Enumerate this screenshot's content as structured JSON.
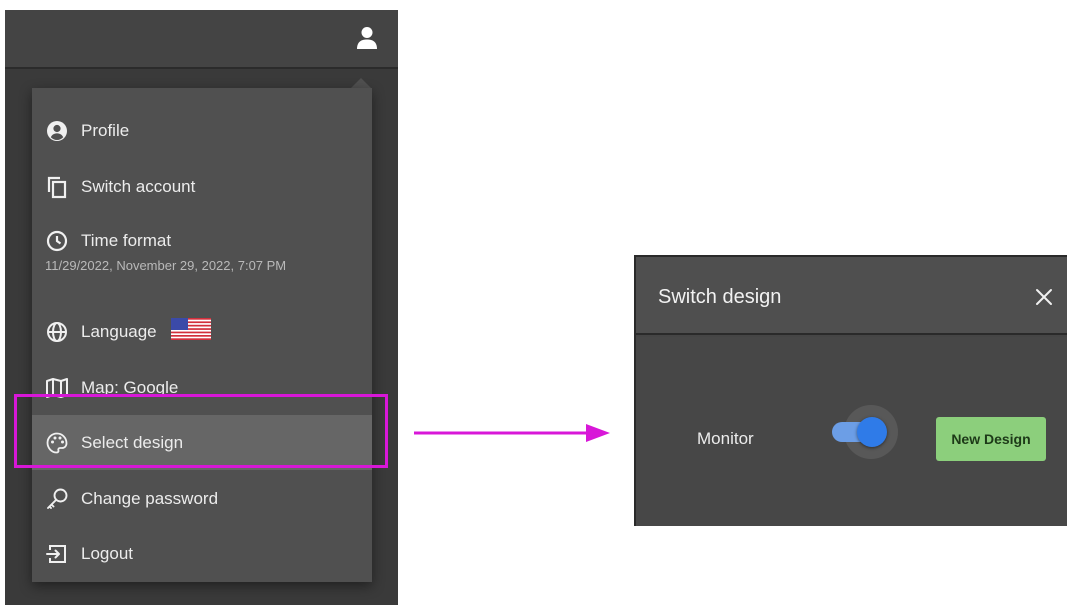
{
  "menu": {
    "items": [
      {
        "label": "Profile",
        "icon": "account-circle-icon"
      },
      {
        "label": "Switch account",
        "icon": "copy-icon"
      },
      {
        "label": "Time format",
        "sub": "11/29/2022, November 29, 2022, 7:07 PM",
        "icon": "clock-icon"
      },
      {
        "label": "Language",
        "icon": "globe-icon",
        "flag": "us-flag-icon"
      },
      {
        "label": "Map: Google",
        "icon": "map-icon"
      },
      {
        "label": "Select design",
        "icon": "palette-icon",
        "active": true
      },
      {
        "label": "Change password",
        "icon": "key-icon"
      },
      {
        "label": "Logout",
        "icon": "logout-icon"
      }
    ]
  },
  "dialog": {
    "title": "Switch design",
    "monitor_label": "Monitor",
    "toggle_on": true,
    "new_design_label": "New Design"
  },
  "colors": {
    "highlight": "#d817d8",
    "arrow": "#d817d8",
    "toggle": "#2f7be8",
    "new_design_button": "#8ccf7c"
  }
}
